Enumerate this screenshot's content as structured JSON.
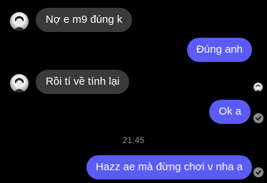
{
  "messages": [
    {
      "direction": "incoming",
      "text": "Nợ e m9 đúng k"
    },
    {
      "direction": "outgoing",
      "text": "Đúng anh"
    },
    {
      "direction": "incoming",
      "text": "Rồi tí về tính lại"
    },
    {
      "direction": "outgoing",
      "text": "Ok a"
    },
    {
      "direction": "outgoing",
      "text": "Hazz ae mà đừng chơi v nha a"
    }
  ],
  "timestamp": "21:45",
  "colors": {
    "background": "#000000",
    "incoming_bubble": "#3a3a3c",
    "outgoing_bubble": "#5b5bf6",
    "timestamp_text": "#8e8e93"
  },
  "icons": {
    "sender_avatar": "avatar-icon",
    "seen_indicator": "seen-avatar-icon",
    "sent_status": "check-circle-icon"
  }
}
